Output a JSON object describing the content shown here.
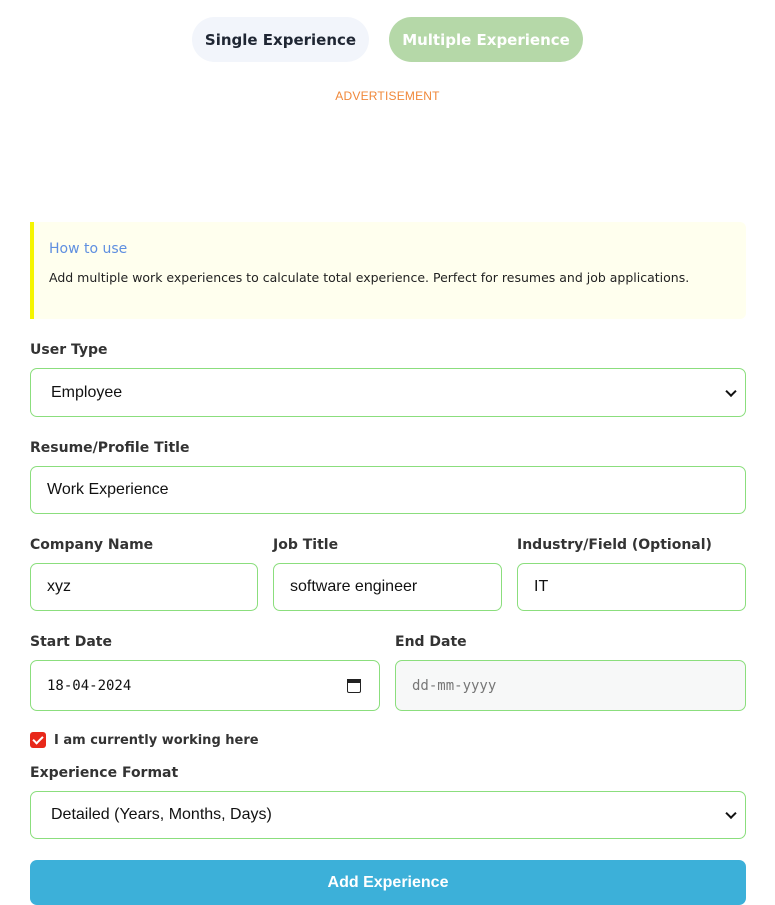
{
  "tabs": {
    "single": "Single Experience",
    "multiple": "Multiple Experience"
  },
  "ad_label": "ADVERTISEMENT",
  "how_to": {
    "title": "How to use",
    "text": "Add multiple work experiences to calculate total experience. Perfect for resumes and job applications."
  },
  "form": {
    "user_type": {
      "label": "User Type",
      "value": "Employee"
    },
    "profile_title": {
      "label": "Resume/Profile Title",
      "value": "Work Experience"
    },
    "company": {
      "label": "Company Name",
      "value": "xyz"
    },
    "job_title": {
      "label": "Job Title",
      "value": "software engineer"
    },
    "industry": {
      "label": "Industry/Field (Optional)",
      "value": "IT"
    },
    "start_date": {
      "label": "Start Date",
      "value": "18-04-2024"
    },
    "end_date": {
      "label": "End Date",
      "placeholder": "dd-mm-yyyy"
    },
    "currently_working": {
      "label": "I am currently working here",
      "checked": true
    },
    "experience_format": {
      "label": "Experience Format",
      "value": "Detailed (Years, Months, Days)"
    }
  },
  "add_button": "Add Experience",
  "colors": {
    "accent_green": "#b5d8a8",
    "field_border": "#8bde7d",
    "button_blue": "#3cb0d9",
    "checkbox_red": "#e8281a",
    "ad_orange": "#f0883a"
  }
}
